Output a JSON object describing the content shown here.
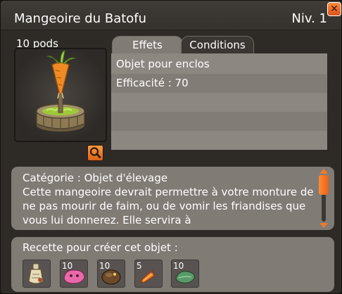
{
  "window": {
    "title": "Mangeoire du Batofu",
    "level": "Niv. 1",
    "close_glyph": "✕"
  },
  "item": {
    "weight": "10 pods",
    "image_icon": "batofu-feeder-carrot-icon",
    "inspect_icon": "magnifier-icon"
  },
  "tabs": [
    {
      "label": "Effets",
      "active": true
    },
    {
      "label": "Conditions",
      "active": false
    }
  ],
  "effects": [
    "Objet pour enclos",
    "Efficacité : 70",
    "",
    "",
    ""
  ],
  "description": "Catégorie : Objet d'élevage\nCette mangeoire devrait permettre à votre monture de ne pas mourir de faim, ou de vomir les friandises que vous lui donnerez. Elle servira à",
  "recipe": {
    "label": "Recette pour créer cet objet :",
    "ingredients": [
      {
        "qty": "",
        "icon": "scroll-bottle-icon"
      },
      {
        "qty": "10",
        "icon": "pink-blob-icon"
      },
      {
        "qty": "10",
        "icon": "brown-creature-icon"
      },
      {
        "qty": "5",
        "icon": "orange-flame-icon"
      },
      {
        "qty": "10",
        "icon": "green-leaf-icon"
      }
    ]
  },
  "colors": {
    "accent": "#f07a2a",
    "panel": "#807b75",
    "window_bg": "#2e2b27"
  }
}
